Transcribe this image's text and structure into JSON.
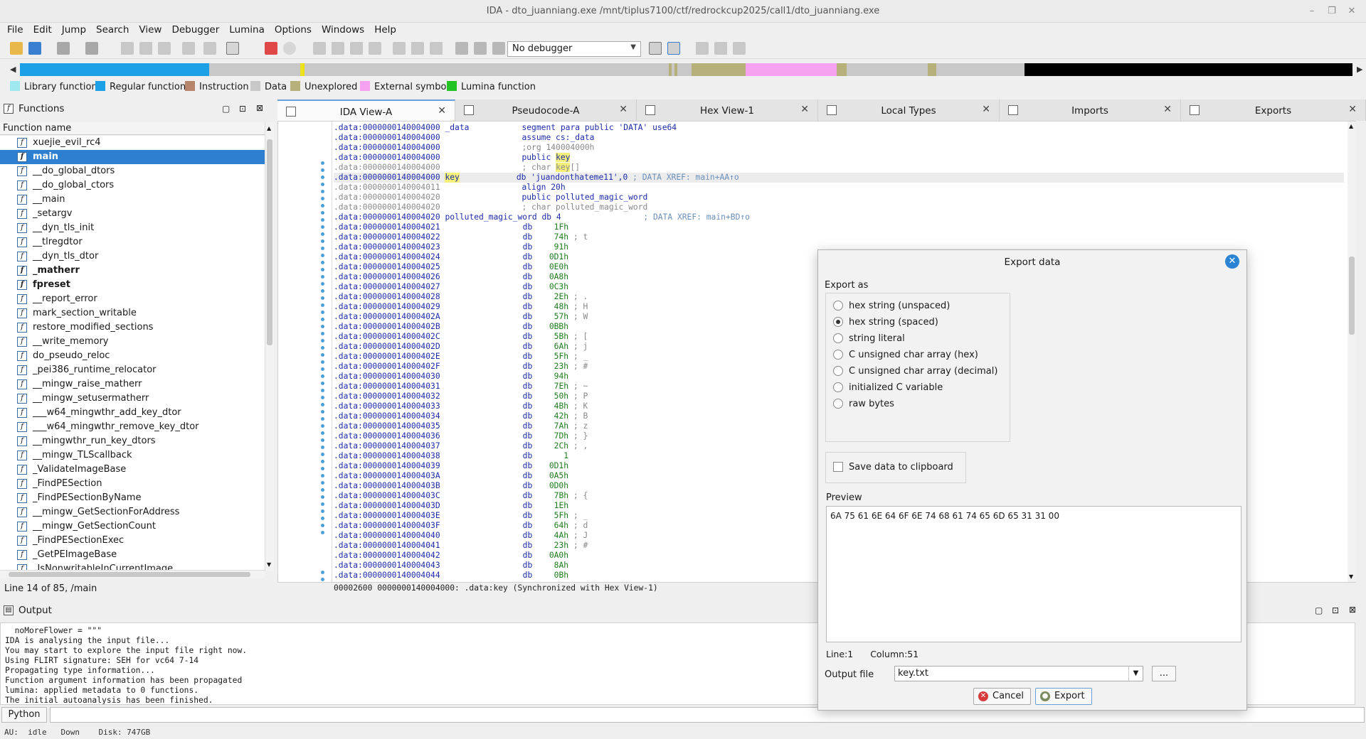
{
  "window": {
    "title": "IDA - dto_juanniang.exe /mnt/tiplus7100/ctf/redrockcup2025/call1/dto_juanniang.exe"
  },
  "menu": [
    "File",
    "Edit",
    "Jump",
    "Search",
    "View",
    "Debugger",
    "Lumina",
    "Options",
    "Windows",
    "Help"
  ],
  "toolbar": {
    "debugger_select": "No debugger"
  },
  "colors": {
    "library_function": "#9fe8f0",
    "regular_function": "#1ea0e6",
    "instruction": "#b7856b",
    "data": "#c8c8c8",
    "unexplored": "#b6b07a",
    "external_symbol": "#f6a2f0",
    "lumina_function": "#22c322",
    "selection": "#2f7fd0",
    "highlight": "#f4f07a"
  },
  "legend": {
    "library_function": "Library function",
    "regular_function": "Regular function",
    "instruction": "Instruction",
    "data": "Data",
    "unexplored": "Unexplored",
    "external_symbol": "External symbol",
    "lumina_function": "Lumina function"
  },
  "functions": {
    "title": "Functions",
    "header": "Function name",
    "items": [
      "xuejie_evil_rc4",
      "main",
      "__do_global_dtors",
      "__do_global_ctors",
      "__main",
      "_setargv",
      "__dyn_tls_init",
      "__tlregdtor",
      "__dyn_tls_dtor",
      "_matherr",
      "fpreset",
      "__report_error",
      "mark_section_writable",
      "restore_modified_sections",
      "__write_memory",
      "do_pseudo_reloc",
      "_pei386_runtime_relocator",
      "__mingw_raise_matherr",
      "__mingw_setusermatherr",
      "___w64_mingwthr_add_key_dtor",
      "___w64_mingwthr_remove_key_dtor",
      "__mingwthr_run_key_dtors",
      "__mingw_TLScallback",
      "_ValidateImageBase",
      "_FindPESection",
      "_FindPESectionByName",
      "__mingw_GetSectionForAddress",
      "__mingw_GetSectionCount",
      "_FindPESectionExec",
      "_GetPEImageBase",
      "_IsNonwritableInCurrentImage"
    ],
    "selected": "main",
    "status": "Line 14 of 85, /main"
  },
  "tabs": [
    "IDA View-A",
    "Pseudocode-A",
    "Hex View-1",
    "Local Types",
    "Imports",
    "Exports"
  ],
  "ida_view": {
    "header_lines": [
      {
        "addr": ".data:0000000140004000",
        "label": "_data",
        "text": "segment para public 'DATA' use64"
      },
      {
        "addr": ".data:0000000140004000",
        "label": "",
        "text": "assume cs:_data"
      },
      {
        "addr": ".data:0000000140004000",
        "label": "",
        "text": ";org 140004000h"
      },
      {
        "addr": ".data:0000000140004000",
        "label": "",
        "text": "public key"
      },
      {
        "addr": ".data:0000000140004000",
        "label": "",
        "text": "; char key[]"
      },
      {
        "addr": ".data:0000000140004000",
        "label": "key",
        "text": "db 'juandonthateme11',0",
        "xref": "; DATA XREF: main+AA↑o"
      },
      {
        "addr": ".data:0000000140004011",
        "label": "",
        "text": "align 20h"
      },
      {
        "addr": ".data:0000000140004020",
        "label": "",
        "text": "public polluted_magic_word"
      },
      {
        "addr": ".data:0000000140004020",
        "label": "",
        "text": "; char polluted_magic_word"
      },
      {
        "addr": ".data:0000000140004020",
        "label": "polluted_magic_word",
        "text": "db 4",
        "xref": "; DATA XREF: main+BD↑o"
      }
    ],
    "db_lines": [
      {
        "addr": "0000000140004021",
        "val": "1Fh",
        "c": ""
      },
      {
        "addr": "0000000140004022",
        "val": "74h",
        "c": "t"
      },
      {
        "addr": "0000000140004023",
        "val": "91h",
        "c": ""
      },
      {
        "addr": "0000000140004024",
        "val": "0D1h",
        "c": ""
      },
      {
        "addr": "0000000140004025",
        "val": "0E0h",
        "c": ""
      },
      {
        "addr": "0000000140004026",
        "val": "0A8h",
        "c": ""
      },
      {
        "addr": "0000000140004027",
        "val": "0C3h",
        "c": ""
      },
      {
        "addr": "0000000140004028",
        "val": "2Eh",
        "c": "."
      },
      {
        "addr": "0000000140004029",
        "val": "48h",
        "c": "H"
      },
      {
        "addr": "000000014000402A",
        "val": "57h",
        "c": "W"
      },
      {
        "addr": "000000014000402B",
        "val": "0BBh",
        "c": ""
      },
      {
        "addr": "000000014000402C",
        "val": "5Bh",
        "c": "["
      },
      {
        "addr": "000000014000402D",
        "val": "6Ah",
        "c": "j"
      },
      {
        "addr": "000000014000402E",
        "val": "5Fh",
        "c": "_"
      },
      {
        "addr": "000000014000402F",
        "val": "23h",
        "c": "#"
      },
      {
        "addr": "0000000140004030",
        "val": "94h",
        "c": ""
      },
      {
        "addr": "0000000140004031",
        "val": "7Eh",
        "c": "~"
      },
      {
        "addr": "0000000140004032",
        "val": "50h",
        "c": "P"
      },
      {
        "addr": "0000000140004033",
        "val": "4Bh",
        "c": "K"
      },
      {
        "addr": "0000000140004034",
        "val": "42h",
        "c": "B"
      },
      {
        "addr": "0000000140004035",
        "val": "7Ah",
        "c": "z"
      },
      {
        "addr": "0000000140004036",
        "val": "7Dh",
        "c": "}"
      },
      {
        "addr": "0000000140004037",
        "val": "2Ch",
        "c": ","
      },
      {
        "addr": "0000000140004038",
        "val": "1",
        "c": ""
      },
      {
        "addr": "0000000140004039",
        "val": "0D1h",
        "c": ""
      },
      {
        "addr": "000000014000403A",
        "val": "0A5h",
        "c": ""
      },
      {
        "addr": "000000014000403B",
        "val": "0D0h",
        "c": ""
      },
      {
        "addr": "000000014000403C",
        "val": "7Bh",
        "c": "{"
      },
      {
        "addr": "000000014000403D",
        "val": "1Eh",
        "c": ""
      },
      {
        "addr": "000000014000403E",
        "val": "5Fh",
        "c": "_"
      },
      {
        "addr": "000000014000403F",
        "val": "64h",
        "c": "d"
      },
      {
        "addr": "0000000140004040",
        "val": "4Ah",
        "c": "J"
      },
      {
        "addr": "0000000140004041",
        "val": "23h",
        "c": "#"
      },
      {
        "addr": "0000000140004042",
        "val": "0A0h",
        "c": ""
      },
      {
        "addr": "0000000140004043",
        "val": "8Ah",
        "c": ""
      },
      {
        "addr": "0000000140004044",
        "val": "0Bh",
        "c": ""
      }
    ],
    "status": "00002600 0000000140004000: .data:key (Synchronized with Hex View-1)"
  },
  "output": {
    "title": "Output",
    "lines": [
      "  noMoreFlower = \"\"\"",
      "IDA is analysing the input file...",
      "You may start to explore the input file right now.",
      "Using FLIRT signature: SEH for vc64 7-14",
      "Propagating type information...",
      "Function argument information has been propagated",
      "lumina: applied metadata to 0 functions.",
      "The initial autoanalysis has been finished."
    ],
    "python_button": "Python"
  },
  "statusbar": {
    "text": "AU:  idle   Down    Disk: 747GB"
  },
  "export_dialog": {
    "title": "Export data",
    "export_as_label": "Export as",
    "options": [
      "hex string (unspaced)",
      "hex string (spaced)",
      "string literal",
      "C unsigned char array (hex)",
      "C unsigned char array (decimal)",
      "initialized C variable",
      "raw bytes"
    ],
    "selected_option": "hex string (spaced)",
    "clipboard_label": "Save data to clipboard",
    "preview_label": "Preview",
    "preview_text": "6A 75 61 6E 64 6F 6E 74 68 61 74 65 6D 65 31 31 00",
    "line": "Line:1",
    "column": "Column:51",
    "output_file_label": "Output file",
    "output_file_value": "key.txt",
    "browse_label": "...",
    "cancel_label": "Cancel",
    "export_label": "Export"
  }
}
